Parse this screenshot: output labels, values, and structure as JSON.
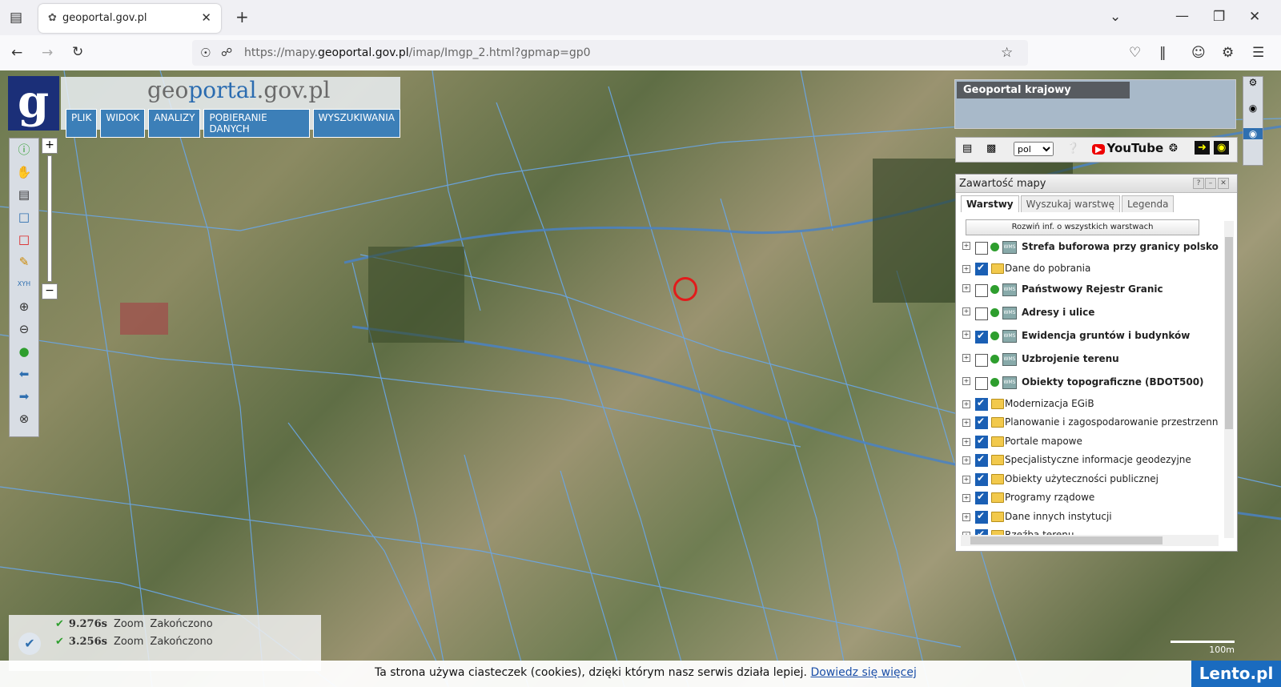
{
  "browser": {
    "tab_title": "geoportal.gov.pl",
    "url_prefix": "https://mapy.",
    "url_domain": "geoportal.gov.pl",
    "url_suffix": "/imap/Imgp_2.html?gpmap=gp0"
  },
  "header": {
    "site_title_a": "geo",
    "site_title_b": "portal",
    "site_title_c": ".gov.pl",
    "menu": [
      "PLIK",
      "WIDOK",
      "ANALIZY",
      "POBIERANIE DANYCH",
      "WYSZUKIWANIA"
    ]
  },
  "overview": {
    "label": "Geoportal krajowy"
  },
  "iconbar": {
    "language": "pol",
    "youtube": "YouTube"
  },
  "panel": {
    "title": "Zawartość mapy",
    "tabs": [
      "Warstwy",
      "Wyszukaj warstwę",
      "Legenda"
    ],
    "expand_all": "Rozwiń inf. o wszystkich warstwach",
    "layers": [
      {
        "name": "Strefa buforowa przy granicy polsko-biał",
        "checked": false,
        "type": "wms"
      },
      {
        "name": "Dane do pobrania",
        "checked": true,
        "type": "folder"
      },
      {
        "name": "Państwowy Rejestr Granic",
        "checked": false,
        "type": "wms"
      },
      {
        "name": "Adresy i ulice",
        "checked": false,
        "type": "wms"
      },
      {
        "name": "Ewidencja gruntów i budynków",
        "checked": true,
        "type": "wms"
      },
      {
        "name": "Uzbrojenie terenu",
        "checked": false,
        "type": "wms"
      },
      {
        "name": "Obiekty topograficzne (BDOT500)",
        "checked": false,
        "type": "wms"
      },
      {
        "name": "Modernizacja EGiB",
        "checked": true,
        "type": "folder"
      },
      {
        "name": "Planowanie i zagospodarowanie przestrzenne",
        "checked": true,
        "type": "folder"
      },
      {
        "name": "Portale mapowe",
        "checked": true,
        "type": "folder"
      },
      {
        "name": "Specjalistyczne informacje geodezyjne",
        "checked": true,
        "type": "folder"
      },
      {
        "name": "Obiekty użyteczności publicznej",
        "checked": true,
        "type": "folder"
      },
      {
        "name": "Programy rządowe",
        "checked": true,
        "type": "folder"
      },
      {
        "name": "Dane innych instytucji",
        "checked": true,
        "type": "folder"
      },
      {
        "name": "Rzeźba terenu",
        "checked": true,
        "type": "folder"
      }
    ]
  },
  "log": [
    {
      "time": "9.276s",
      "action": "Zoom",
      "status": "Zakończono"
    },
    {
      "time": "3.256s",
      "action": "Zoom",
      "status": "Zakończono"
    }
  ],
  "scale": {
    "label": "100m"
  },
  "cookie": {
    "text": "Ta strona używa ciasteczek (cookies), dzięki którym nasz serwis działa lepiej. ",
    "link": "Dowiedz się więcej"
  },
  "watermark": "Lento.pl"
}
